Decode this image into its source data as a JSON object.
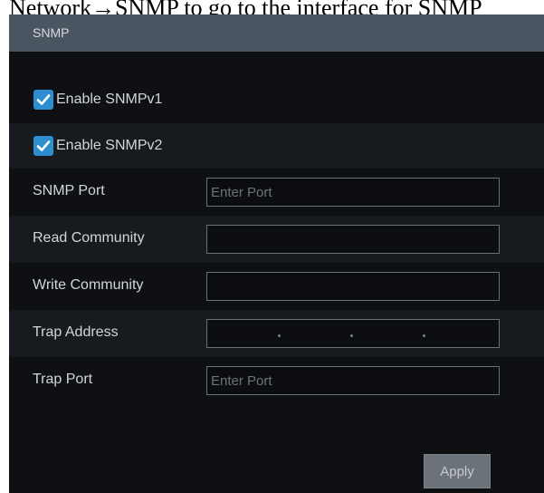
{
  "doc_caption": "Network→SNMP to go to the interface for SNMP",
  "panel": {
    "title": "SNMP",
    "enable_v1": {
      "label": "Enable SNMPv1",
      "checked": true
    },
    "enable_v2": {
      "label": "Enable SNMPv2",
      "checked": true
    },
    "snmp_port": {
      "label": "SNMP Port",
      "value": "",
      "placeholder": "Enter Port"
    },
    "read_community": {
      "label": "Read Community",
      "value": ""
    },
    "write_community": {
      "label": "Write Community",
      "value": ""
    },
    "trap_address": {
      "label": "Trap Address",
      "value": ""
    },
    "trap_port": {
      "label": "Trap Port",
      "value": "",
      "placeholder": "Enter Port"
    },
    "apply_label": "Apply"
  },
  "colors": {
    "header": "#4b5561",
    "panel_bg": "#0d0f13",
    "checkbox": "#2e8fd0",
    "apply_button": "#6c7279"
  }
}
